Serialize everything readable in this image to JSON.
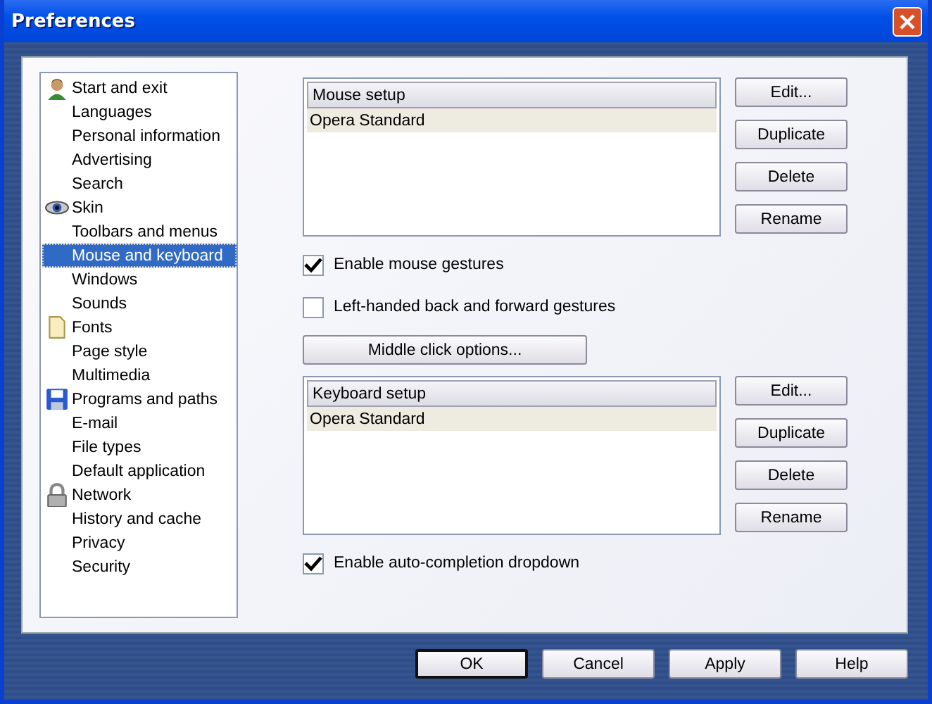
{
  "window": {
    "title": "Preferences"
  },
  "sidebar": {
    "items": [
      {
        "label": "Start and exit",
        "kind": "section",
        "selected": false
      },
      {
        "label": "Languages",
        "kind": "page",
        "selected": false
      },
      {
        "label": "Personal information",
        "kind": "page",
        "selected": false
      },
      {
        "label": "Advertising",
        "kind": "page",
        "selected": false
      },
      {
        "label": "Search",
        "kind": "page",
        "selected": false
      },
      {
        "label": "Skin",
        "kind": "section",
        "selected": false
      },
      {
        "label": "Toolbars and menus",
        "kind": "page",
        "selected": false
      },
      {
        "label": "Mouse and keyboard",
        "kind": "page",
        "selected": true
      },
      {
        "label": "Windows",
        "kind": "page",
        "selected": false
      },
      {
        "label": "Sounds",
        "kind": "page",
        "selected": false
      },
      {
        "label": "Fonts",
        "kind": "section",
        "selected": false
      },
      {
        "label": "Page style",
        "kind": "page",
        "selected": false
      },
      {
        "label": "Multimedia",
        "kind": "page",
        "selected": false
      },
      {
        "label": "Programs and paths",
        "kind": "section",
        "selected": false
      },
      {
        "label": "E-mail",
        "kind": "page",
        "selected": false
      },
      {
        "label": "File types",
        "kind": "page",
        "selected": false
      },
      {
        "label": "Default application",
        "kind": "page",
        "selected": false
      },
      {
        "label": "Network",
        "kind": "section",
        "selected": false
      },
      {
        "label": "History and cache",
        "kind": "page",
        "selected": false
      },
      {
        "label": "Privacy",
        "kind": "page",
        "selected": false
      },
      {
        "label": "Security",
        "kind": "page",
        "selected": false
      }
    ]
  },
  "content": [
    {
      "kind": "list",
      "header": "Mouse setup",
      "rows": [
        {
          "label": "Opera Standard",
          "selected": true
        }
      ],
      "buttons": [
        "Edit...",
        "Duplicate",
        "Delete",
        "Rename"
      ]
    },
    {
      "kind": "checkbox",
      "label": "Enable mouse gestures",
      "checked": true
    },
    {
      "kind": "checkbox",
      "label": "Left-handed back and forward gestures",
      "checked": false
    },
    {
      "kind": "button",
      "label": "Middle click options..."
    },
    {
      "kind": "list",
      "header": "Keyboard setup",
      "rows": [
        {
          "label": "Opera Standard",
          "selected": true
        }
      ],
      "buttons": [
        "Edit...",
        "Duplicate",
        "Delete",
        "Rename"
      ]
    },
    {
      "kind": "checkbox",
      "label": "Enable auto-completion dropdown",
      "checked": true
    }
  ],
  "buttons": [
    {
      "label": "OK",
      "default": true
    },
    {
      "label": "Cancel",
      "default": false
    },
    {
      "label": "Apply",
      "default": false
    },
    {
      "label": "Help",
      "default": false
    }
  ]
}
